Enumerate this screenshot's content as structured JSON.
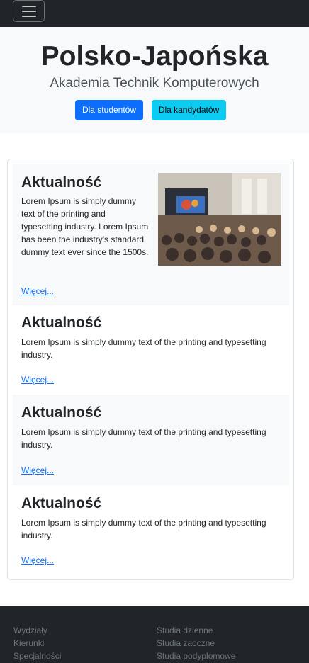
{
  "navbar": {
    "toggler_icon": "hamburger-icon"
  },
  "hero": {
    "title": "Polsko-Japońska",
    "subtitle": "Akademia Technik Komputerowych",
    "buttons": {
      "students": "Dla studentów",
      "candidates": "Dla kandydatów"
    }
  },
  "news": [
    {
      "title": "Aktualność",
      "text": "Lorem Ipsum is simply dummy text of the printing and typesetting industry. Lorem Ipsum has been the industry's standard dummy text ever since the 1500s.",
      "link": "Więcej..."
    },
    {
      "title": "Aktualność",
      "text": "Lorem Ipsum is simply dummy text of the printing and typesetting industry.",
      "link": "Więcej..."
    },
    {
      "title": "Aktualność",
      "text": "Lorem Ipsum is simply dummy text of the printing and typesetting industry.",
      "link": "Więcej..."
    },
    {
      "title": "Aktualność",
      "text": "Lorem Ipsum is simply dummy text of the printing and typesetting industry.",
      "link": "Więcej..."
    }
  ],
  "footer": {
    "col1": [
      "Wydziały",
      "Kierunki",
      "Specjalności"
    ],
    "col2": [
      "Studia dzienne",
      "Studia zaoczne",
      "Studia podyplomowe"
    ]
  },
  "colors": {
    "primary": "#0d6efd",
    "info": "#0dcaf0",
    "dark": "#212529",
    "light": "#f8f9fa"
  }
}
